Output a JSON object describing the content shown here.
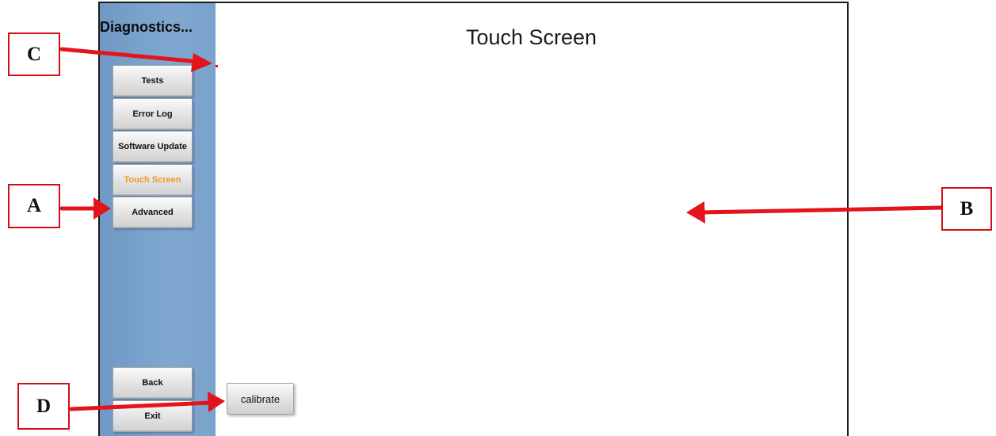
{
  "sidebar": {
    "title": "Diagnostics...",
    "buttons": [
      {
        "label": "Tests",
        "active": false
      },
      {
        "label": "Error Log",
        "active": false
      },
      {
        "label": "Software Update",
        "active": false
      },
      {
        "label": "Touch Screen",
        "active": true
      },
      {
        "label": "Advanced",
        "active": false
      }
    ],
    "back_label": "Back",
    "exit_label": "Exit"
  },
  "main": {
    "title": "Touch Screen",
    "calibrate_label": "calibrate"
  },
  "callouts": {
    "a": "A",
    "b": "B",
    "c": "C",
    "d": "D"
  },
  "colors": {
    "sidebar_blue": "#7aa3cc",
    "active_text": "#f39a1e",
    "callout_red": "#d10f17"
  }
}
